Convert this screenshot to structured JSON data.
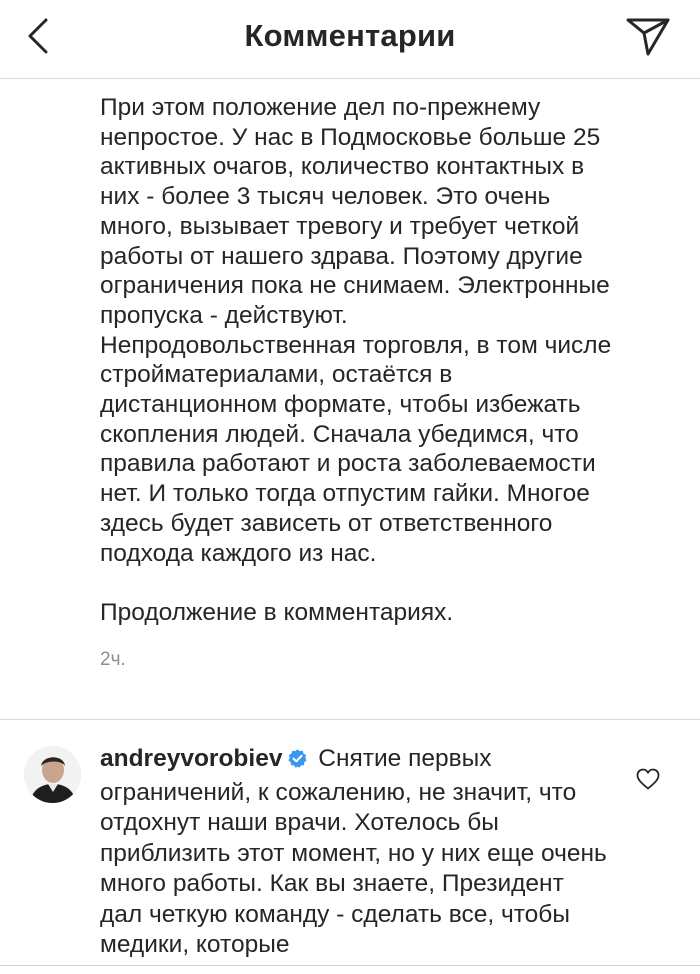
{
  "header": {
    "title": "Комментарии",
    "back_icon": "chevron-left-icon",
    "send_icon": "paper-plane-icon"
  },
  "caption": {
    "text": "При этом положение дел по-прежнему\nнепростое. У нас в Подмосковье больше 25\nактивных очагов, количество контактных в\nних - более 3 тысяч человек. Это очень\nмного, вызывает тревогу и требует четкой\nработы от нашего здрава. Поэтому другие\nограничения пока не снимаем. Электронные\nпропуска - действуют.\nНепродовольственная торговля, в том числе\nстройматериалами, остаётся в\nдистанционном формате, чтобы избежать\nскопления людей. Сначала убедимся, что\nправила работают и роста заболеваемости\nнет. И только тогда отпустим гайки. Многое\nздесь будет зависеть от ответственного\nподхода каждого из нас.",
    "more": "Продолжение в комментариях.",
    "time": "2ч."
  },
  "comment": {
    "username": "andreyvorobiev",
    "text": "Снятие первых ограничений, к сожалению, не значит, что отдохнут наши врачи. Хотелось бы приблизить этот момент, но у них еще очень много работы. Как вы знаете, Президент дал четкую команду - сделать все, чтобы медики, которые",
    "verified_icon": "verified-badge-icon",
    "like_icon": "heart-outline-icon"
  },
  "colors": {
    "text": "#262626",
    "secondary": "#8e8e8e",
    "divider": "#dbdbdb",
    "verified": "#3897f0"
  }
}
